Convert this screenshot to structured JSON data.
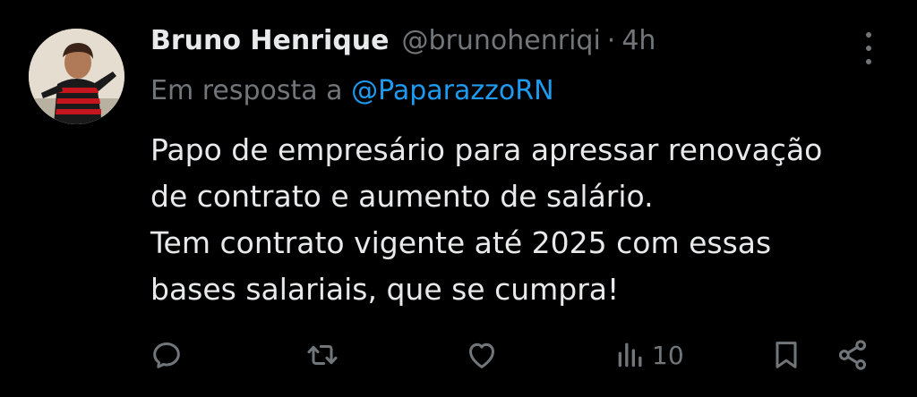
{
  "tweet": {
    "author_name": "Bruno Henrique",
    "handle": "@brunohenriqi",
    "separator": "·",
    "time": "4h",
    "reply_prefix": "Em resposta a",
    "reply_to": "@PaparazzoRN",
    "text_lines": [
      "Papo de empresário para apressar renovação",
      "de contrato e aumento de salário.",
      "Tem contrato vigente até 2025 com essas",
      "bases salariais, que se cumpra!"
    ]
  },
  "actions": {
    "reply_icon": "reply-icon",
    "retweet_icon": "retweet-icon",
    "like_icon": "heart-icon",
    "views_icon": "views-icon",
    "views_count": "10",
    "bookmark_icon": "bookmark-icon",
    "share_icon": "share-icon"
  },
  "colors": {
    "background": "#000000",
    "text": "#e7e9ea",
    "secondary": "#71767b",
    "link": "#1d9bf0"
  }
}
